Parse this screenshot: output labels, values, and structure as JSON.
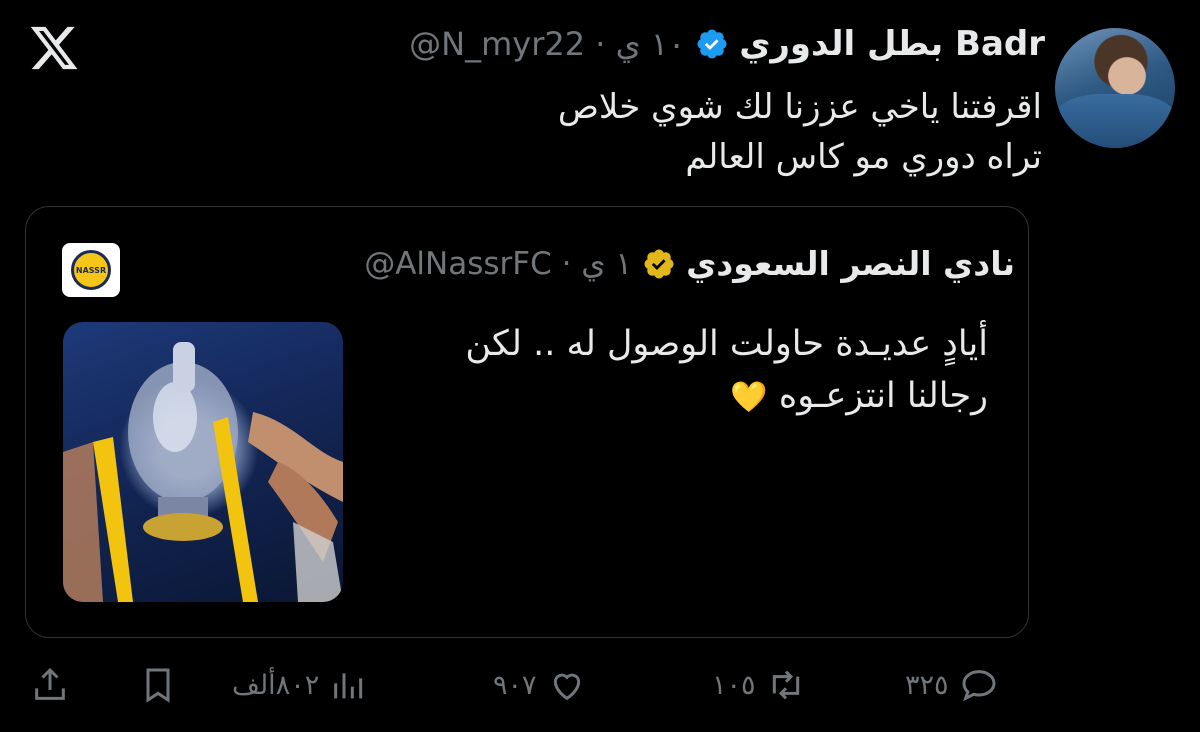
{
  "tweet": {
    "display_name": "بطل الدوري Badr",
    "handle_time": "@N_myr22 · ١٠ ي",
    "text_line1": "اقرفتنا ياخي عززنا لك شوي خلاص",
    "text_line2": "تراه دوري مو كاس العالم"
  },
  "quote": {
    "display_name": "نادي النصر السعودي",
    "handle_time": "@AlNassrFC · ١ ي",
    "logo_text": "NASSR",
    "text_line1": "أيادٍ عديـدة حاولت الوصول له .. لكن",
    "text_line2": "رجالنا انتزعـوه",
    "emoji": "💛"
  },
  "actions": {
    "replies": "٣٢٥",
    "retweets": "١٠٥",
    "likes": "٩٠٧",
    "views": "٨٠٢ألف"
  },
  "icons": {
    "logo": "x-logo-icon",
    "verified": "verified-badge-icon",
    "reply": "reply-icon",
    "retweet": "retweet-icon",
    "like": "heart-icon",
    "views": "views-chart-icon",
    "bookmark": "bookmark-icon",
    "share": "share-icon"
  },
  "colors": {
    "background": "#000000",
    "text": "#e7e9ea",
    "muted": "#71767b",
    "verified_blue": "#1d9bf0",
    "verified_gold": "#e2b719",
    "border": "#2f3336"
  }
}
